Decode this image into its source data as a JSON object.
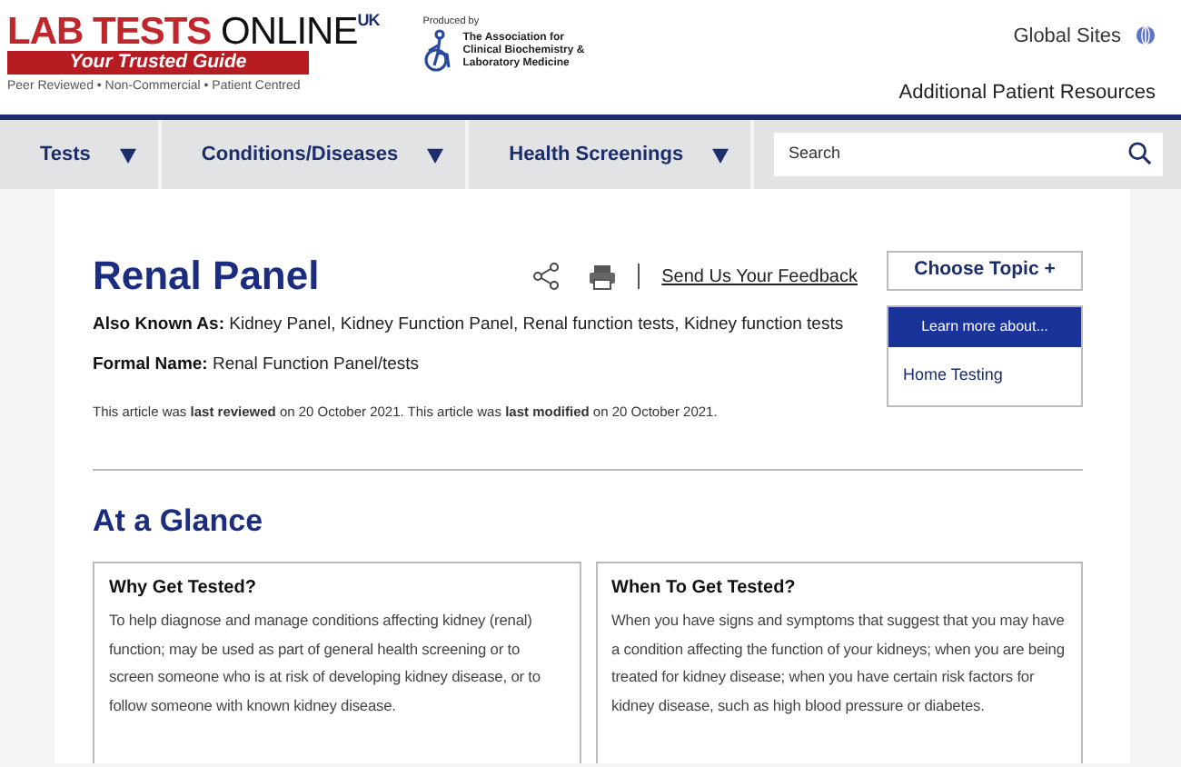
{
  "header": {
    "logo": {
      "brand": "LAB TESTS",
      "brand_light": "ONLINE",
      "region": "UK",
      "tagline_bar": "Your Trusted Guide",
      "tagline": "Peer Reviewed • Non-Commercial • Patient Centred"
    },
    "producer": {
      "label": "Produced by",
      "org_lines": [
        "The Association for",
        "Clinical Biochemistry &",
        "Laboratory Medicine"
      ]
    },
    "global_sites": "Global Sites",
    "resources_link": "Additional Patient Resources"
  },
  "nav": {
    "items": [
      {
        "label": "Tests"
      },
      {
        "label": "Conditions/Diseases"
      },
      {
        "label": "Health Screenings"
      }
    ],
    "search": {
      "placeholder": "Search"
    }
  },
  "article": {
    "title": "Renal Panel",
    "feedback_link": "Send Us Your Feedback",
    "meta": [
      {
        "label": "Also Known As:",
        "value": "Kidney Panel, Kidney Function Panel, Renal function tests, Kidney function tests"
      },
      {
        "label": "Formal Name:",
        "value": "Renal Function Panel/tests"
      }
    ],
    "dates": "This article was **last reviewed** on 20 October 2021. This article was **last modified** on 20 October 2021."
  },
  "sidebar": {
    "choose_topic": "Choose Topic +",
    "learn_more": {
      "heading": "Learn more about...",
      "items": [
        "Home Testing"
      ]
    }
  },
  "glance": {
    "heading": "At a Glance",
    "cards": [
      {
        "title": "Why Get Tested?",
        "body": [
          {
            "kind": "text",
            "text": "To help diagnose and manage conditions affecting kidney (renal) function; may be used as part of general health screening or to screen someone who is at risk of developing "
          },
          {
            "kind": "link",
            "text": "kidney disease"
          },
          {
            "kind": "text",
            "text": ", or to follow someone with known kidney disease."
          }
        ]
      },
      {
        "title": "When To Get Tested?",
        "body": [
          {
            "kind": "text",
            "text": "When you have signs and symptoms that suggest that you may have a condition affecting the function of your kidneys; when you are being treated for kidney disease; when you have certain risk factors for kidney disease, such as "
          },
          {
            "kind": "link",
            "text": "high blood pressure"
          },
          {
            "kind": "text",
            "text": " or "
          },
          {
            "kind": "link",
            "text": "diabetes"
          },
          {
            "kind": "text",
            "text": "."
          }
        ]
      }
    ]
  }
}
